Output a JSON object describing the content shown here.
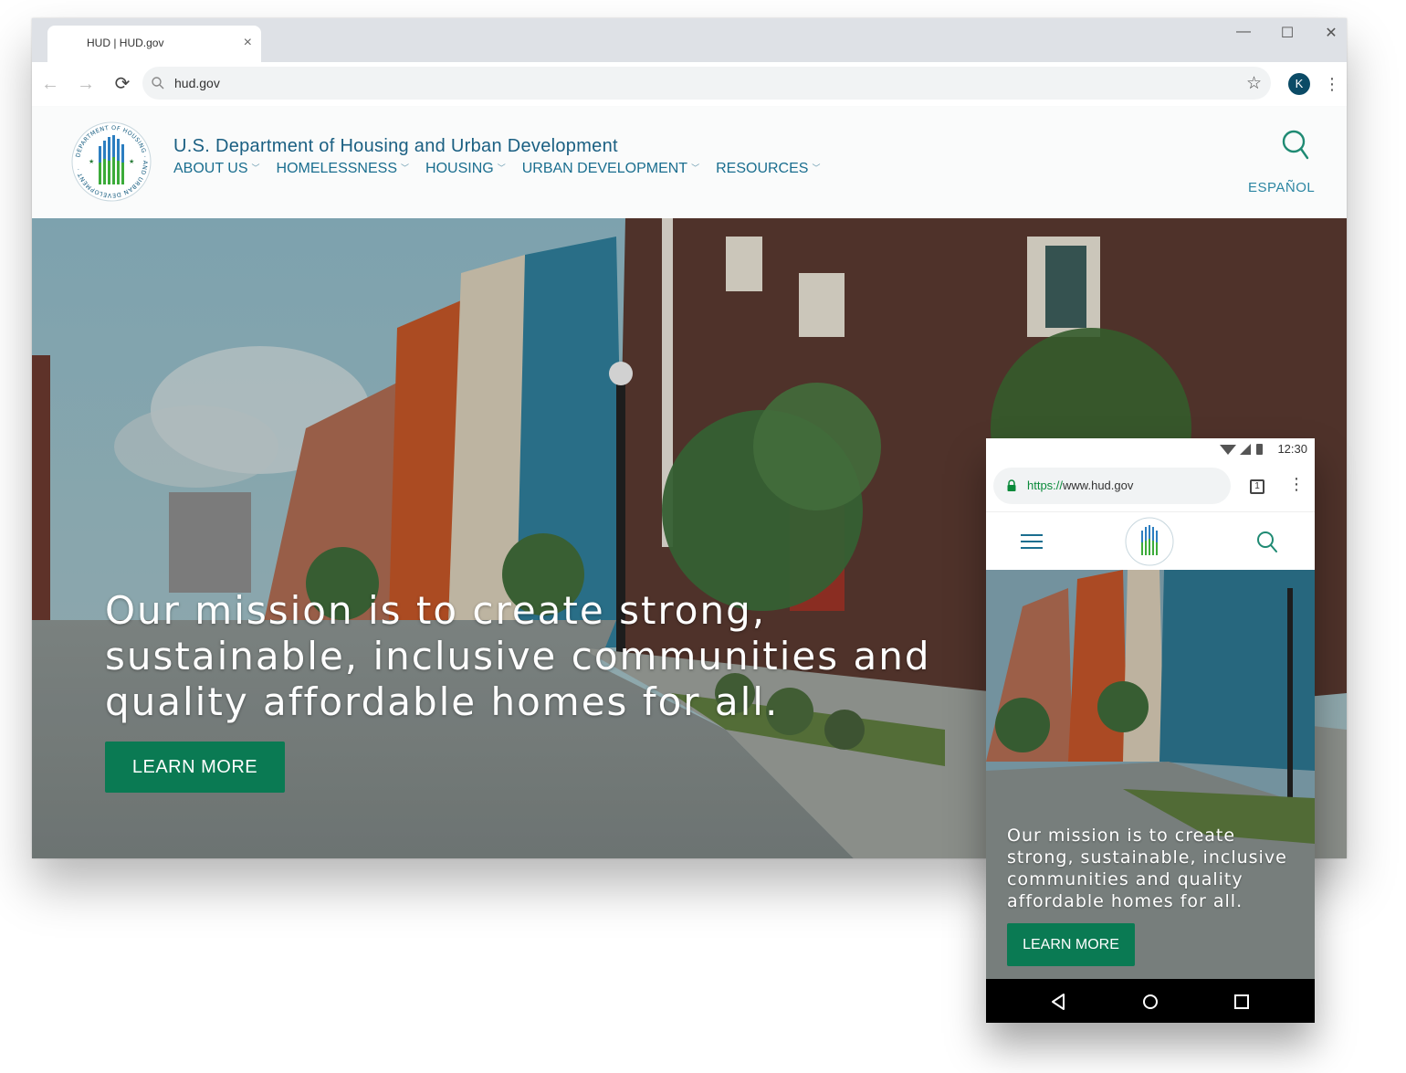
{
  "desktop": {
    "tab": {
      "title": "HUD | HUD.gov",
      "close": "×"
    },
    "window_controls": {
      "minimize": "—",
      "maximize": "☐",
      "close": "✕"
    },
    "toolbar": {
      "url": "hud.gov",
      "profile_initial": "K",
      "menu": "⋮"
    },
    "site": {
      "title": "U.S. Department of Housing and Urban Development",
      "nav": [
        "ABOUT US",
        "HOMELESSNESS",
        "HOUSING",
        "URBAN DEVELOPMENT",
        "RESOURCES"
      ],
      "language_link": "ESPAÑOL",
      "hero": {
        "mission": "Our mission is to create strong, sustainable, inclusive communities and quality affordable homes for all.",
        "cta": "LEARN MORE"
      },
      "seal_text": "DEPARTMENT OF HOUSING AND URBAN DEVELOPMENT"
    }
  },
  "mobile": {
    "status": {
      "time": "12:30"
    },
    "url_scheme": "https://",
    "url_host": "www.hud.gov",
    "tab_count": "1",
    "hero": {
      "mission": "Our mission is to create strong, sustainable, inclusive communities and quality affordable homes for all.",
      "cta": "LEARN MORE"
    }
  },
  "colors": {
    "brand_blue": "#1a5f82",
    "cta_green": "#0a7a53",
    "nav_link": "#1a6e8f"
  }
}
